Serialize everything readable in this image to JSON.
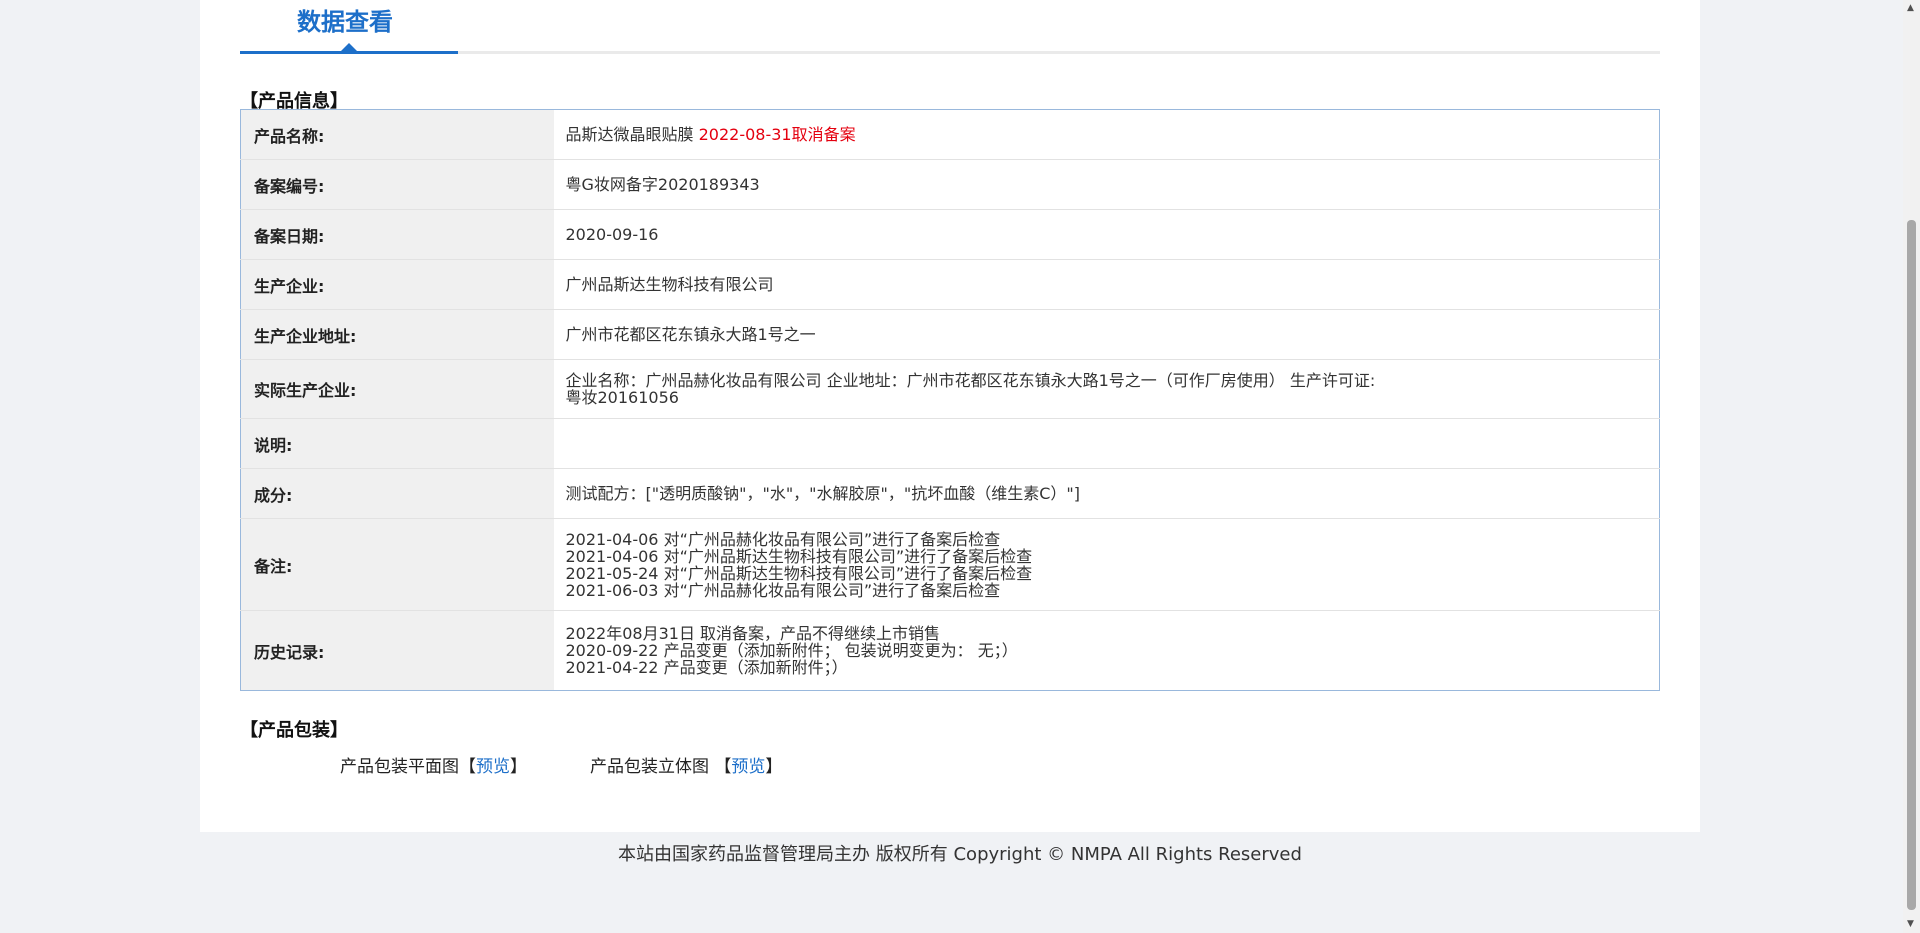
{
  "header": {
    "title": "数据查看"
  },
  "product_info": {
    "section_title": "【产品信息】",
    "rows": [
      {
        "label": "产品名称:",
        "value": "品斯达微晶眼贴膜",
        "status": "2022-08-31取消备案"
      },
      {
        "label": "备案编号:",
        "value": "粤G妆网备字2020189343"
      },
      {
        "label": "备案日期:",
        "value": "2020-09-16"
      },
      {
        "label": "生产企业:",
        "value": "广州品斯达生物科技有限公司"
      },
      {
        "label": "生产企业地址:",
        "value": "广州市花都区花东镇永大路1号之一"
      },
      {
        "label": "实际生产企业:",
        "lines": [
          "企业名称：广州品赫化妆品有限公司 企业地址：广州市花都区花东镇永大路1号之一（可作厂房使用） 生产许可证:",
          "粤妆20161056"
        ]
      },
      {
        "label": "说明:",
        "value": ""
      },
      {
        "label": "成分:",
        "value": "测试配方：[\"透明质酸钠\"，\"水\"，\"水解胶原\"，\"抗坏血酸（维生素C）\"]"
      },
      {
        "label": "备注:",
        "lines": [
          "2021-04-06 对“广州品赫化妆品有限公司”进行了备案后检查",
          "2021-04-06 对“广州品斯达生物科技有限公司”进行了备案后检查",
          "2021-05-24 对“广州品斯达生物科技有限公司”进行了备案后检查",
          "2021-06-03 对“广州品赫化妆品有限公司”进行了备案后检查"
        ]
      },
      {
        "label": "历史记录:",
        "lines": [
          "2022年08月31日 取消备案，产品不得继续上市销售",
          "2020-09-22 产品变更（添加新附件；  包装说明变更为： 无；）",
          "2021-04-22 产品变更（添加新附件；）"
        ]
      }
    ]
  },
  "packaging": {
    "section_title": "【产品包装】",
    "flat_label": "产品包装平面图",
    "solid_label": "产品包装立体图",
    "bracket_open": "【",
    "bracket_close": "】",
    "preview_label": "预览"
  },
  "footer": {
    "text": "本站由国家药品监督管理局主办 版权所有 Copyright © NMPA All Rights Reserved"
  },
  "colors": {
    "accent": "#1d6fc9",
    "status_red": "#e4000f",
    "page_bg": "#f0f2f5",
    "label_bg": "#f0f0f0",
    "table_border": "#99b8dc"
  },
  "icons": {
    "scroll_up": "▲",
    "scroll_down": "▼"
  }
}
